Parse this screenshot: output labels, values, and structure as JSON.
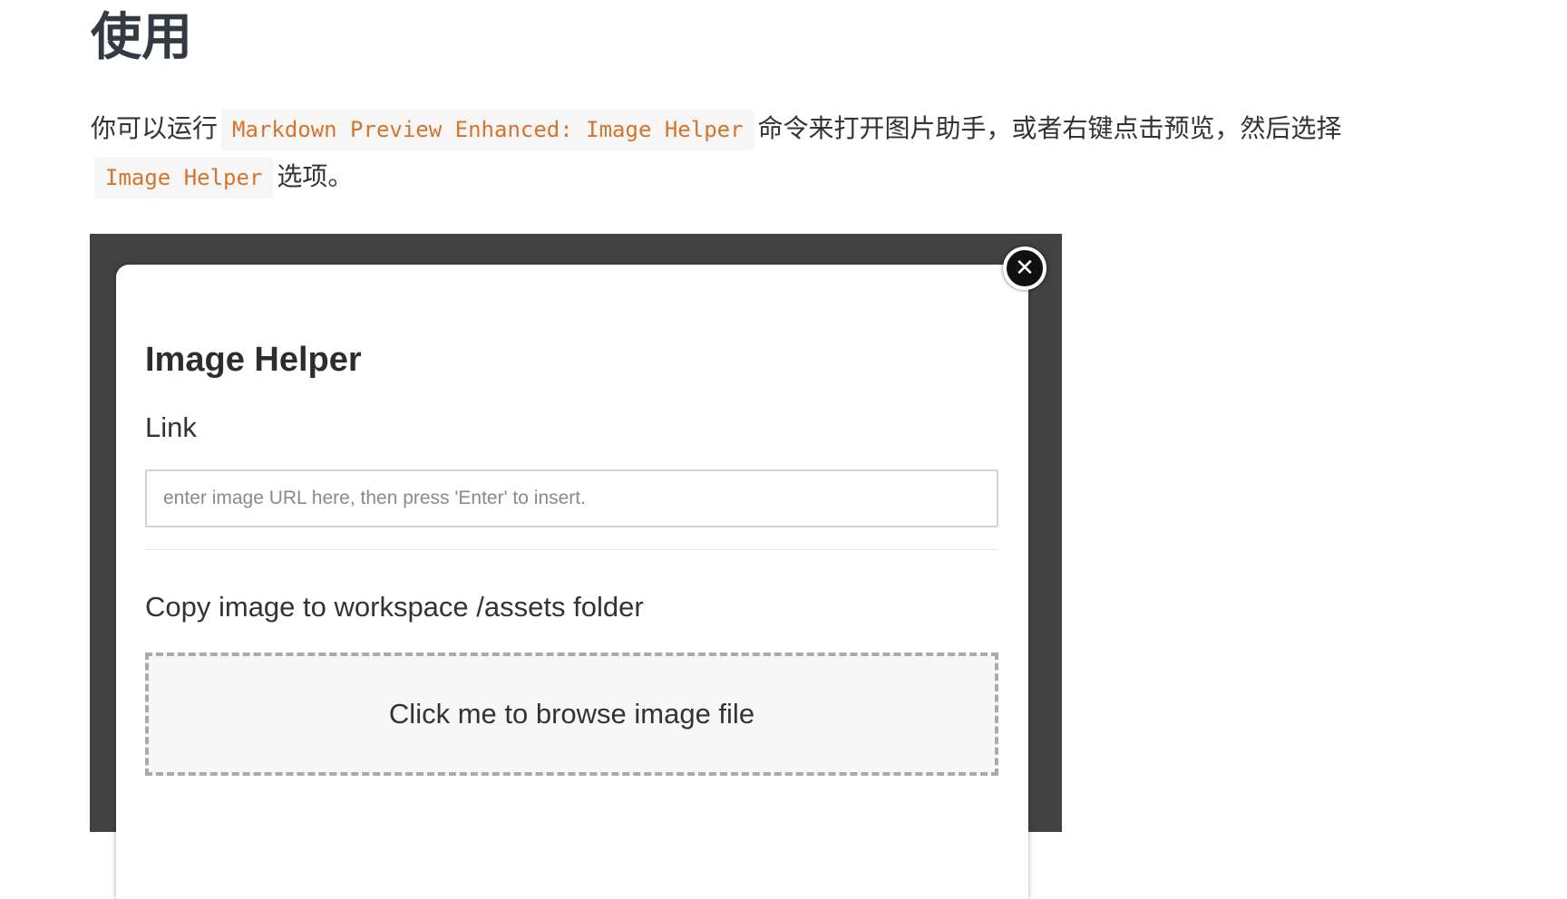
{
  "doc": {
    "title": "使用",
    "para_prefix": "你可以运行",
    "command_code": "Markdown Preview Enhanced: Image Helper",
    "para_middle": "命令来打开图片助手，或者右键点击预览，然后选择",
    "option_code": "Image Helper",
    "para_suffix": "选项。"
  },
  "image_helper": {
    "title": "Image Helper",
    "close_icon": "close-icon",
    "link_label": "Link",
    "url_placeholder": "enter image URL here, then press 'Enter' to insert.",
    "url_value": "",
    "copy_label": "Copy image to workspace /assets folder",
    "browse_label": "Click me to browse image file"
  },
  "colors": {
    "code_text": "#d6742b",
    "code_bg": "#f6f6f6",
    "screenshot_bg": "#424242"
  }
}
